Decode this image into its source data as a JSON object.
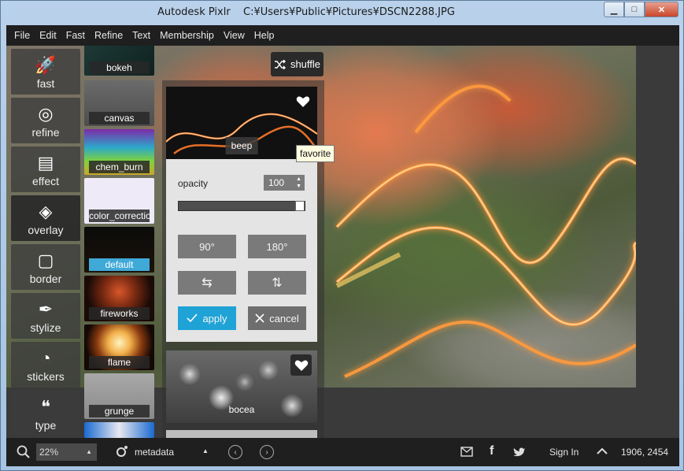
{
  "window": {
    "app_title": "Autodesk Pixlr",
    "file_path": "C:¥Users¥Public¥Pictures¥DSCN2288.JPG",
    "minimize": "▁",
    "maximize": "□",
    "close": "✕"
  },
  "menu": [
    "File",
    "Edit",
    "Fast",
    "Refine",
    "Text",
    "Membership",
    "View",
    "Help"
  ],
  "tools": [
    {
      "label": "fast",
      "icon": "rocket-icon",
      "glyph": "🚀"
    },
    {
      "label": "refine",
      "icon": "refine-icon",
      "glyph": "◎"
    },
    {
      "label": "effect",
      "icon": "film-icon",
      "glyph": "▤"
    },
    {
      "label": "overlay",
      "icon": "layers-icon",
      "glyph": "◈"
    },
    {
      "label": "border",
      "icon": "frame-icon",
      "glyph": "▢"
    },
    {
      "label": "stylize",
      "icon": "feather-icon",
      "glyph": "✒"
    },
    {
      "label": "stickers",
      "icon": "sticker-icon",
      "glyph": "◔"
    },
    {
      "label": "type",
      "icon": "quote-icon",
      "glyph": "❝"
    }
  ],
  "overlays": [
    {
      "label": "bokeh"
    },
    {
      "label": "canvas"
    },
    {
      "label": "chem_burn"
    },
    {
      "label": "color_correction"
    },
    {
      "label": "default",
      "selected": true
    },
    {
      "label": "fireworks"
    },
    {
      "label": "flame"
    },
    {
      "label": "grunge"
    }
  ],
  "shuffle": {
    "label": "shuffle",
    "icon": "shuffle-icon"
  },
  "cards": {
    "beep": "beep",
    "bocea": "bocea"
  },
  "tooltip": "favorite",
  "panel": {
    "opacity_label": "opacity",
    "opacity_value": "100",
    "opacity_level": 1.0,
    "rotate_90": "90°",
    "rotate_180": "180°",
    "flip_h_glyph": "⇆",
    "flip_v_glyph": "⇅",
    "apply": "apply",
    "cancel": "cancel"
  },
  "status": {
    "zoom": "22%",
    "metadata": "metadata",
    "sign_in": "Sign In",
    "dimensions": "1906, 2454"
  },
  "colors": {
    "accent": "#1fa3d6",
    "menubar": "#1f1f1f"
  }
}
